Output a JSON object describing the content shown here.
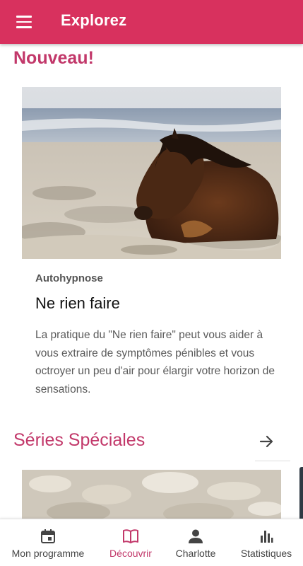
{
  "appbar": {
    "title": "Explorez",
    "menu_icon": "menu-icon",
    "color": "#d8315e"
  },
  "new_section": {
    "title": "Nouveau!",
    "card": {
      "image": "pony-lying-on-frosty-grass",
      "category": "Autohypnose",
      "title": "Ne rien faire",
      "description": "La pratique du \"Ne rien faire\" peut vous aider à vous extraire de symptômes pénibles et vous octroyer un peu d'air pour élargir votre horizon de sensations."
    }
  },
  "series_section": {
    "title": "Séries Spéciales",
    "arrow_icon": "arrow-right-icon",
    "image": "shells-on-sand"
  },
  "accent_color": "#c2386a",
  "bottom_nav": {
    "active": "Découvrir",
    "items": [
      {
        "label": "Mon programme",
        "icon": "calendar-icon"
      },
      {
        "label": "Découvrir",
        "icon": "book-icon"
      },
      {
        "label": "Charlotte",
        "icon": "person-icon"
      },
      {
        "label": "Statistiques",
        "icon": "bar-chart-icon"
      }
    ]
  }
}
